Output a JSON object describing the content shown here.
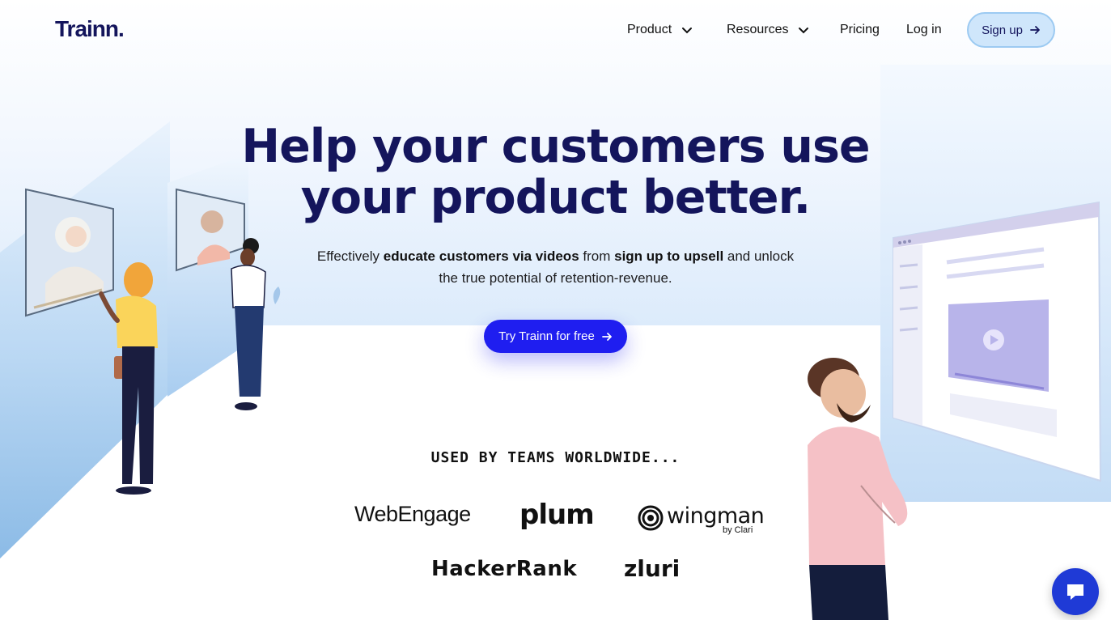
{
  "brand": {
    "logo_text": "Trainn.",
    "accent_color": "#2d5bff",
    "primary_color": "#14155c"
  },
  "nav": {
    "product_label": "Product",
    "resources_label": "Resources",
    "pricing_label": "Pricing",
    "login_label": "Log in",
    "signup_label": "Sign up"
  },
  "hero": {
    "title_line1": "Help your customers use",
    "title_line2": "your product better.",
    "sub_1": "Effectively ",
    "sub_bold_1": "educate customers via videos",
    "sub_2": " from ",
    "sub_bold_2": "sign up to upsell",
    "sub_3": " and unlock the true potential of retention-revenue.",
    "cta_label": "Try Trainn for free",
    "cta_color": "#1f1ef0"
  },
  "social_proof": {
    "heading": "USED BY TEAMS WORLDWIDE...",
    "logos": [
      "WebEngage",
      "plum",
      "wingman",
      "by Clari",
      "HackerRank",
      "zluri"
    ]
  },
  "icons": {
    "chevron": "chevron-down-icon",
    "arrow": "arrow-right-icon",
    "chat": "chat-bubble-icon"
  }
}
